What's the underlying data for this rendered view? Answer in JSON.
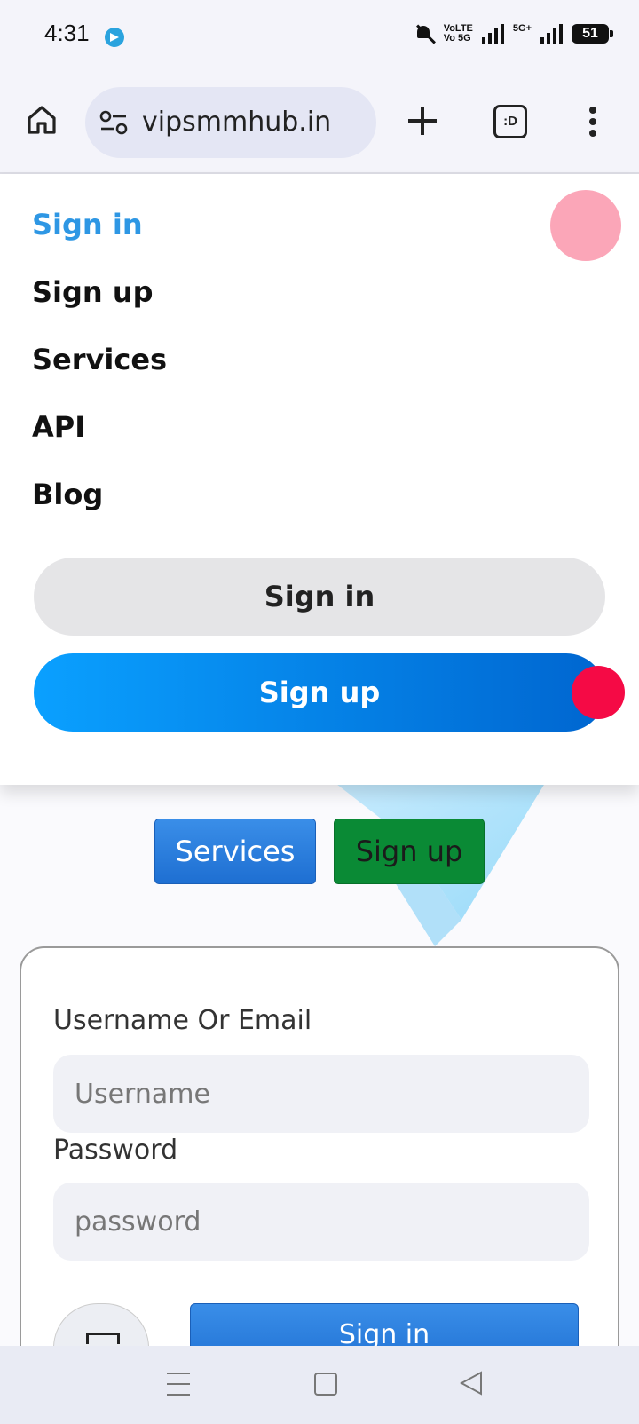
{
  "status_bar": {
    "time": "4:31",
    "volte_top": "VoLTE",
    "volte_bottom": "Vo 5G",
    "network": "5G+",
    "battery": "51"
  },
  "browser": {
    "url": "vipsmmhub.in",
    "tabs_label": ":D"
  },
  "menu": {
    "links": [
      {
        "label": "Sign in",
        "active": true
      },
      {
        "label": "Sign up"
      },
      {
        "label": "Services"
      },
      {
        "label": "API"
      },
      {
        "label": "Blog"
      }
    ],
    "signin_button": "Sign in",
    "signup_button": "Sign up"
  },
  "page": {
    "services_button": "Services",
    "signup_button": "Sign up",
    "form": {
      "username_label": "Username Or Email",
      "username_placeholder": "Username",
      "password_label": "Password",
      "password_placeholder": "password",
      "submit_label": "Sign in"
    }
  },
  "colors": {
    "accent_blue": "#2e97e4",
    "green_button": "#0a8a35",
    "pink_dot": "#fba6b8",
    "red_dot": "#f50a45"
  }
}
